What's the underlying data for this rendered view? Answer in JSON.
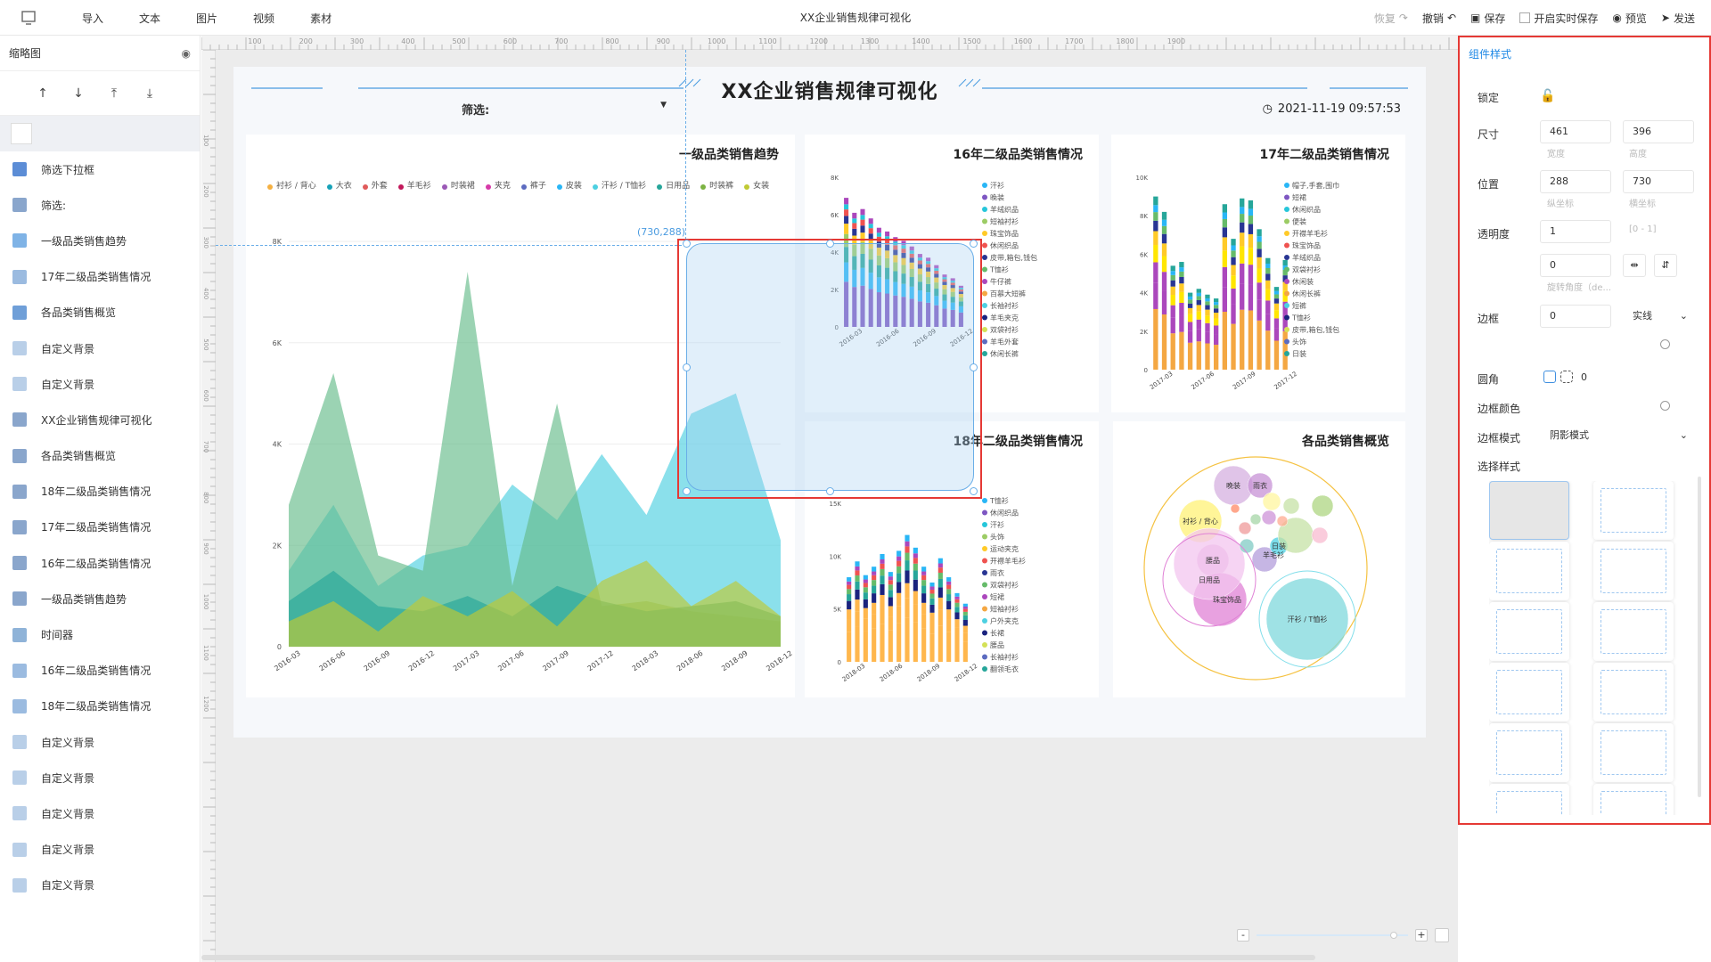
{
  "topbar": {
    "menus": [
      "导入",
      "文本",
      "图片",
      "视频",
      "素材"
    ],
    "title": "XX企业销售规律可视化",
    "actions": {
      "restore": "恢复",
      "undo": "撤销",
      "save": "保存",
      "realtime": "开启实时保存",
      "preview": "预览",
      "publish": "发送"
    }
  },
  "left_panel": {
    "title": "缩略图",
    "layers": [
      {
        "label": "筛选下拉框",
        "icon": "filter-icon"
      },
      {
        "label": "筛选:",
        "icon": "text-icon"
      },
      {
        "label": "一级品类销售趋势",
        "icon": "area-chart-icon"
      },
      {
        "label": "17年二级品类销售情况",
        "icon": "bar-chart-icon"
      },
      {
        "label": "各品类销售概览",
        "icon": "bubble-chart-icon"
      },
      {
        "label": "自定义背景",
        "icon": "background-icon"
      },
      {
        "label": "自定义背景",
        "icon": "background-icon"
      },
      {
        "label": "XX企业销售规律可视化",
        "icon": "text-icon"
      },
      {
        "label": "各品类销售概览",
        "icon": "text-icon"
      },
      {
        "label": "18年二级品类销售情况",
        "icon": "text-icon"
      },
      {
        "label": "17年二级品类销售情况",
        "icon": "text-icon"
      },
      {
        "label": "16年二级品类销售情况",
        "icon": "text-icon"
      },
      {
        "label": "一级品类销售趋势",
        "icon": "text-icon"
      },
      {
        "label": "时间器",
        "icon": "timer-icon"
      },
      {
        "label": "16年二级品类销售情况",
        "icon": "bar-chart-icon"
      },
      {
        "label": "18年二级品类销售情况",
        "icon": "bar-chart-icon"
      },
      {
        "label": "自定义背景",
        "icon": "background-icon"
      },
      {
        "label": "自定义背景",
        "icon": "background-icon"
      },
      {
        "label": "自定义背景",
        "icon": "background-icon"
      },
      {
        "label": "自定义背景",
        "icon": "background-icon"
      },
      {
        "label": "自定义背景",
        "icon": "background-icon"
      }
    ]
  },
  "ruler": {
    "ticks": [
      "0",
      "100",
      "200",
      "300",
      "400",
      "500",
      "600",
      "700",
      "800",
      "900",
      "1000",
      "1100",
      "1200",
      "1300",
      "1400",
      "1500",
      "1600",
      "1700",
      "1800",
      "1900"
    ],
    "vticks": [
      "100",
      "200",
      "300",
      "400",
      "500",
      "600",
      "700",
      "800",
      "900",
      "1000",
      "1100",
      "1200"
    ]
  },
  "screen": {
    "title": "XX企业销售规律可视化",
    "filter_label": "筛选:",
    "datetime": "2021-11-19 09:57:53",
    "selection_coord": "(730,288)"
  },
  "card1": {
    "title": "一级品类销售趋势",
    "legend": [
      {
        "name": "衬衫 / 背心",
        "color": "#f5b041"
      },
      {
        "name": "大衣",
        "color": "#17a2b8"
      },
      {
        "name": "外套",
        "color": "#e05b5b"
      },
      {
        "name": "羊毛衫",
        "color": "#c2185b"
      },
      {
        "name": "时装裙",
        "color": "#9b59b6"
      },
      {
        "name": "夹克",
        "color": "#d63aa8"
      },
      {
        "name": "裤子",
        "color": "#5c6bc0"
      },
      {
        "name": "皮装",
        "color": "#29b6f6"
      },
      {
        "name": "汗衫 / T恤衫",
        "color": "#4dd0e1"
      },
      {
        "name": "日用品",
        "color": "#26a69a"
      },
      {
        "name": "时装裤",
        "color": "#7cb342"
      },
      {
        "name": "女装",
        "color": "#c0ca33"
      }
    ]
  },
  "chart_data": [
    {
      "type": "area",
      "title": "一级品类销售趋势",
      "x": [
        "2016-03",
        "2016-06",
        "2016-09",
        "2016-12",
        "2017-03",
        "2017-06",
        "2017-09",
        "2017-12",
        "2018-03",
        "2018-06",
        "2018-09",
        "2018-12"
      ],
      "ylim": [
        0,
        8000
      ],
      "yticks": [
        "0",
        "2K",
        "4K",
        "6K",
        "8K"
      ],
      "series": [
        {
          "name": "汗衫 / T恤衫",
          "color": "#4dd0e1",
          "values": [
            1500,
            2800,
            1200,
            1800,
            2000,
            3200,
            2500,
            3800,
            2600,
            4600,
            5000,
            2100
          ]
        },
        {
          "name": "日用品",
          "color": "#66bb8a",
          "values": [
            2800,
            5400,
            1800,
            1500,
            7400,
            1200,
            4800,
            800,
            900,
            700,
            600,
            500
          ]
        },
        {
          "name": "大衣",
          "color": "#26a69a",
          "values": [
            900,
            1500,
            800,
            700,
            1000,
            600,
            1200,
            900,
            700,
            800,
            900,
            600
          ]
        },
        {
          "name": "女装",
          "color": "#c0ca33",
          "values": [
            500,
            900,
            300,
            1000,
            600,
            1100,
            400,
            1300,
            1700,
            800,
            1300,
            600
          ]
        }
      ]
    },
    {
      "type": "bar",
      "title": "16年二级品类销售情况",
      "x": [
        "2016-03",
        "2016-06",
        "2016-09",
        "2016-12"
      ],
      "ylim": [
        0,
        8000
      ],
      "yticks": [
        "0",
        "2K",
        "4K",
        "6K",
        "8K"
      ],
      "series_names": [
        "汗衫",
        "晚装",
        "羊绒织品",
        "短袖衬衫",
        "珠宝饰品",
        "休闲织品",
        "皮带,箱包,钱包",
        "T恤衫",
        "牛仔裤",
        "百慕大短裤",
        "长袖衬衫",
        "羊毛夹克",
        "双袋衬衫",
        "羊毛外套",
        "休闲长裤"
      ],
      "totals": [
        6900,
        6100,
        6300,
        5800,
        5300,
        5100,
        4800,
        4600,
        4300,
        3900,
        3700,
        3300,
        2800,
        2600,
        2200
      ]
    },
    {
      "type": "bar",
      "title": "17年二级品类销售情况",
      "x": [
        "2017-03",
        "2017-06",
        "2017-09",
        "2017-12"
      ],
      "ylim": [
        0,
        10000
      ],
      "yticks": [
        "0",
        "2K",
        "4K",
        "6K",
        "8K",
        "10K"
      ],
      "series_names": [
        "帽子,手套,围巾",
        "短裙",
        "休闲织品",
        "便装",
        "开襟羊毛衫",
        "珠宝饰品",
        "羊绒织品",
        "双袋衬衫",
        "休闲装",
        "休闲长裤",
        "短裤",
        "T恤衫",
        "皮带,箱包,钱包",
        "头饰",
        "日装"
      ],
      "totals": [
        9000,
        8200,
        5400,
        5600,
        4000,
        4200,
        3900,
        3700,
        8600,
        6800,
        8900,
        8800,
        7300,
        5800,
        4300,
        5700
      ]
    },
    {
      "type": "bar",
      "title": "18年二级品类销售情况",
      "x": [
        "2018-03",
        "2018-06",
        "2018-09",
        "2018-12"
      ],
      "ylim": [
        0,
        15000
      ],
      "yticks": [
        "0",
        "5K",
        "10K",
        "15K"
      ],
      "series_names": [
        "T恤衫",
        "休闲织品",
        "汗衫",
        "头饰",
        "运动夹克",
        "开襟羊毛衫",
        "雨衣",
        "双袋衬衫",
        "短裙",
        "短袖衬衫",
        "户外夹克",
        "长裙",
        "腰品",
        "长袖衬衫",
        "翻领毛衣"
      ],
      "totals": [
        8000,
        9500,
        8200,
        9000,
        10200,
        8500,
        10500,
        12000,
        10800,
        9000,
        7500,
        9800,
        8000,
        6500,
        5500
      ]
    },
    {
      "type": "scatter",
      "title": "各品类销售概览",
      "labels": [
        "晚装",
        "雨衣",
        "衬衫 / 背心",
        "腰品",
        "日用品",
        "珠宝饰品",
        "日装",
        "羊毛衫",
        "汗衫 / T恤衫"
      ]
    }
  ],
  "card2": {
    "title": "16年二级品类销售情况"
  },
  "card3": {
    "title": "17年二级品类销售情况"
  },
  "card4": {
    "title": "18年二级品类销售情况"
  },
  "card5": {
    "title": "各品类销售概览"
  },
  "right_panel": {
    "title": "组件样式",
    "lock_label": "锁定",
    "size_label": "尺寸",
    "width": "461",
    "height": "396",
    "width_hint": "宽度",
    "height_hint": "高度",
    "pos_label": "位置",
    "pos_x": "288",
    "pos_y": "730",
    "pos_x_hint": "纵坐标",
    "pos_y_hint": "横坐标",
    "opacity_label": "透明度",
    "opacity": "1",
    "opacity_hint": "[0 - 1]",
    "rotate": "0",
    "rotate_hint": "旋转角度（de...",
    "border_label": "边框",
    "border_width": "0",
    "border_style": "实线",
    "radius_label": "圆角",
    "radius_value": "0",
    "border_color_label": "边框颜色",
    "border_mode_label": "边框模式",
    "border_mode": "阴影模式",
    "select_style_label": "选择样式"
  }
}
